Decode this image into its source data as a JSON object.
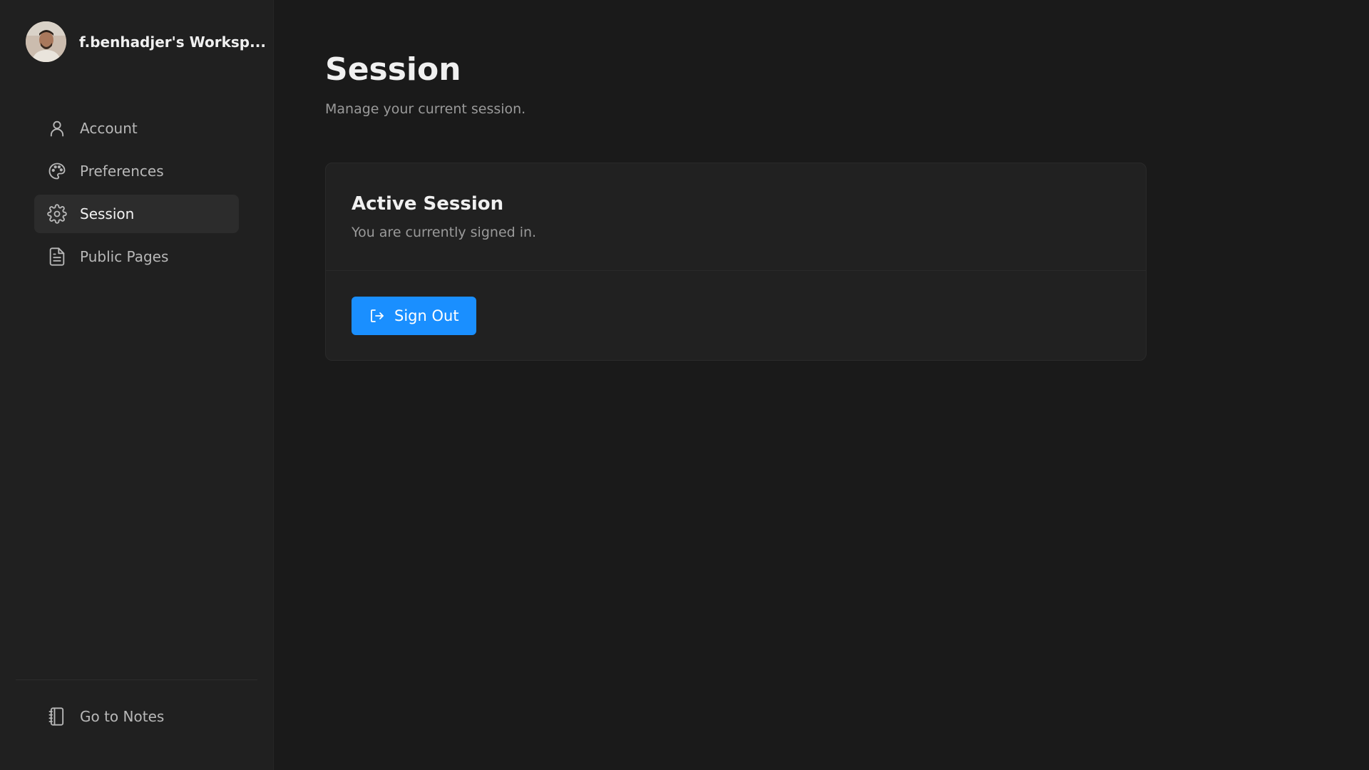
{
  "sidebar": {
    "workspace_name": "f.benhadjer's Worksp...",
    "items": [
      {
        "label": "Account",
        "icon": "user-icon"
      },
      {
        "label": "Preferences",
        "icon": "palette-icon"
      },
      {
        "label": "Session",
        "icon": "gear-icon",
        "active": true
      },
      {
        "label": "Public Pages",
        "icon": "file-text-icon"
      }
    ],
    "bottom": {
      "label": "Go to Notes",
      "icon": "notebook-icon"
    }
  },
  "main": {
    "title": "Session",
    "subtitle": "Manage your current session.",
    "card": {
      "title": "Active Session",
      "description": "You are currently signed in.",
      "button_label": "Sign Out"
    }
  },
  "colors": {
    "accent": "#1a8fff",
    "background": "#1a1a1a",
    "sidebar": "#202020"
  }
}
